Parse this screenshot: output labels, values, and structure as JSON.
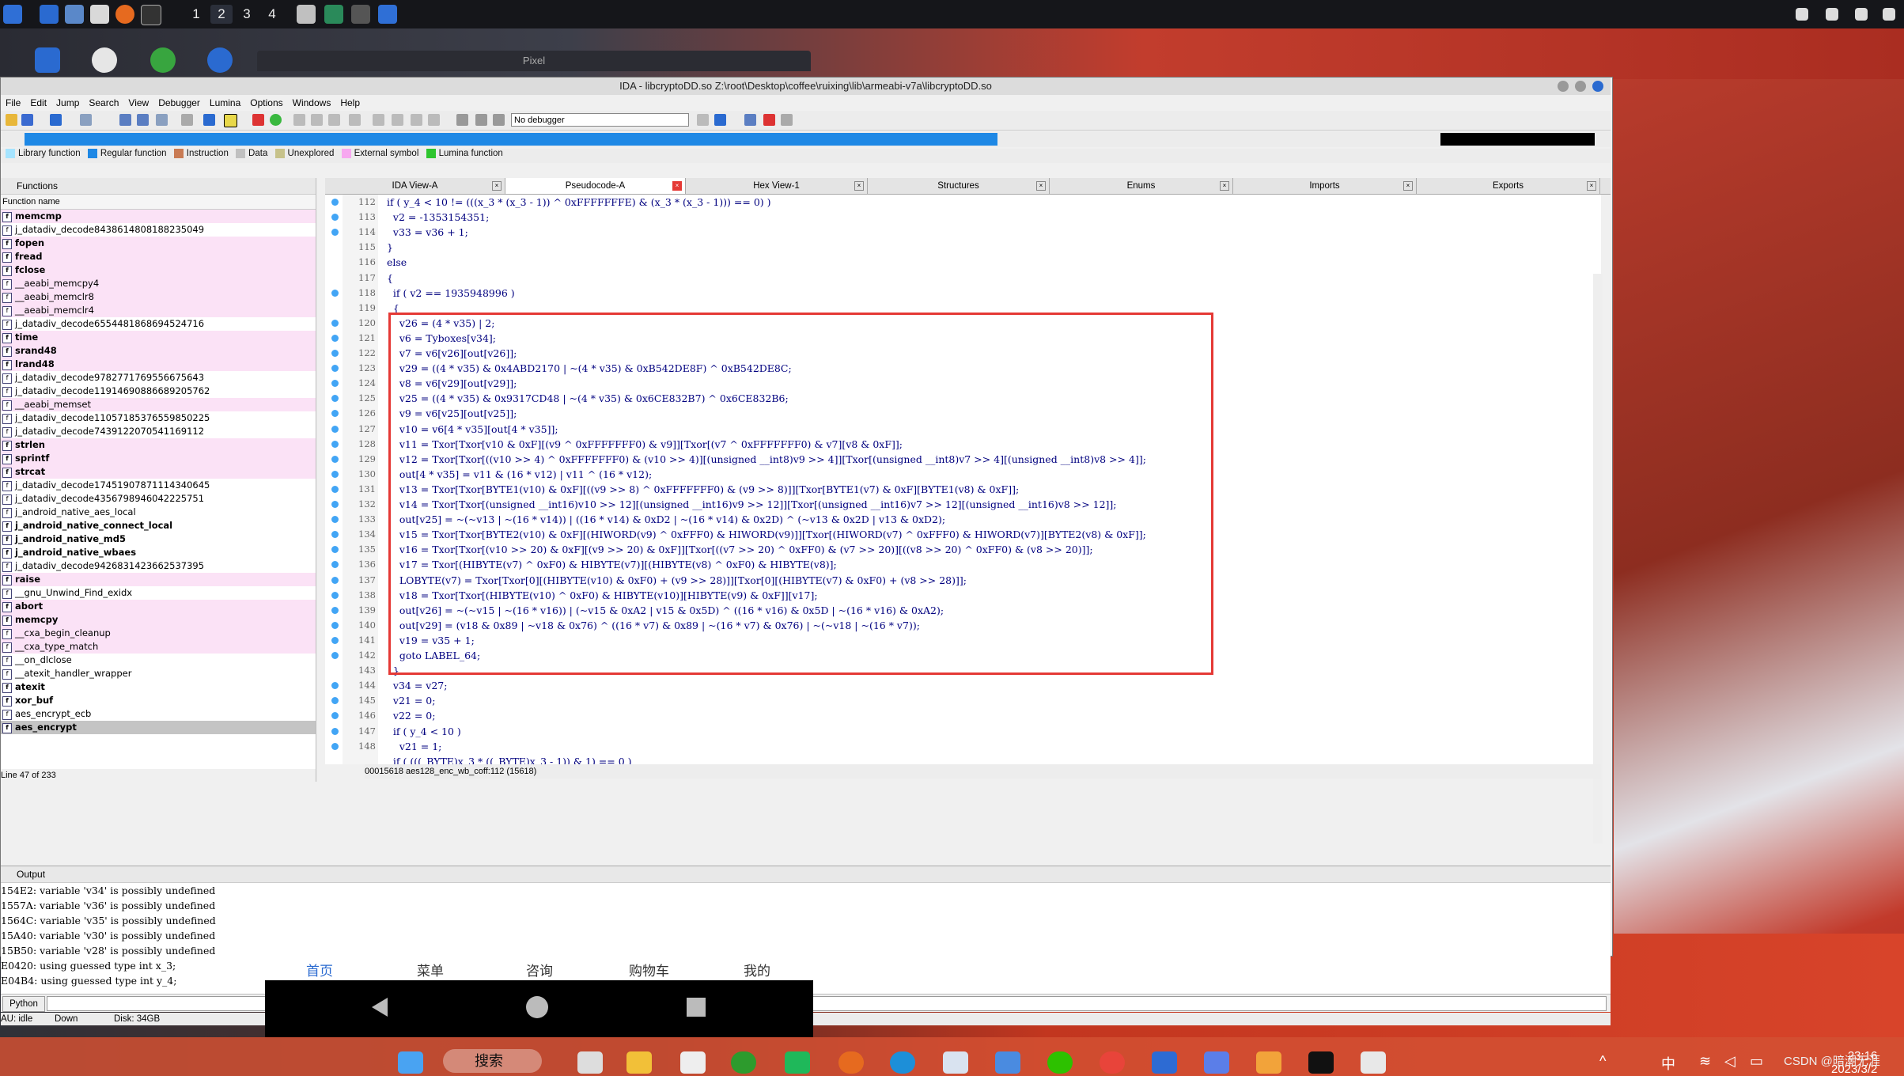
{
  "top_panel": {
    "workspaces": [
      "1",
      "2",
      "3",
      "4"
    ],
    "active_workspace": "2"
  },
  "pixel_window_title": "Pixel",
  "ida": {
    "title": "IDA - libcryptoDD.so Z:\\root\\Desktop\\coffee\\ruixing\\lib\\armeabi-v7a\\libcryptoDD.so",
    "menu": [
      "File",
      "Edit",
      "Jump",
      "Search",
      "View",
      "Debugger",
      "Lumina",
      "Options",
      "Windows",
      "Help"
    ],
    "debugger_select": "No debugger",
    "legend": [
      {
        "label": "Library function",
        "color": "#a6e4ff"
      },
      {
        "label": "Regular function",
        "color": "#1e88e5"
      },
      {
        "label": "Instruction",
        "color": "#c97b54"
      },
      {
        "label": "Data",
        "color": "#c0c0c0"
      },
      {
        "label": "Unexplored",
        "color": "#c7c28a"
      },
      {
        "label": "External symbol",
        "color": "#f7a8f0"
      },
      {
        "label": "Lumina function",
        "color": "#2ec52e"
      }
    ],
    "functions_pane": {
      "title": "Functions",
      "column": "Function name",
      "items": [
        {
          "name": "memcmp",
          "style": "lib bold"
        },
        {
          "name": "j_datadiv_decode8438614808188235049",
          "style": ""
        },
        {
          "name": "fopen",
          "style": "lib bold"
        },
        {
          "name": "fread",
          "style": "lib bold"
        },
        {
          "name": "fclose",
          "style": "lib bold"
        },
        {
          "name": "__aeabi_memcpy4",
          "style": "lib"
        },
        {
          "name": "__aeabi_memclr8",
          "style": "lib"
        },
        {
          "name": "__aeabi_memclr4",
          "style": "lib"
        },
        {
          "name": "j_datadiv_decode6554481868694524716",
          "style": ""
        },
        {
          "name": "time",
          "style": "lib bold"
        },
        {
          "name": "srand48",
          "style": "lib bold"
        },
        {
          "name": "lrand48",
          "style": "lib bold"
        },
        {
          "name": "j_datadiv_decode9782771769556675643",
          "style": ""
        },
        {
          "name": "j_datadiv_decode11914690886689205762",
          "style": ""
        },
        {
          "name": "__aeabi_memset",
          "style": "lib"
        },
        {
          "name": "j_datadiv_decode11057185376559850225",
          "style": ""
        },
        {
          "name": "j_datadiv_decode7439122070541169112",
          "style": ""
        },
        {
          "name": "strlen",
          "style": "lib bold"
        },
        {
          "name": "sprintf",
          "style": "lib bold"
        },
        {
          "name": "strcat",
          "style": "lib bold"
        },
        {
          "name": "j_datadiv_decode17451907871114340645",
          "style": ""
        },
        {
          "name": "j_datadiv_decode4356798946042225751",
          "style": ""
        },
        {
          "name": "j_android_native_aes_local",
          "style": ""
        },
        {
          "name": "j_android_native_connect_local",
          "style": "bold"
        },
        {
          "name": "j_android_native_md5",
          "style": "bold"
        },
        {
          "name": "j_android_native_wbaes",
          "style": "bold"
        },
        {
          "name": "j_datadiv_decode9426831423662537395",
          "style": ""
        },
        {
          "name": "raise",
          "style": "lib bold"
        },
        {
          "name": "__gnu_Unwind_Find_exidx",
          "style": ""
        },
        {
          "name": "abort",
          "style": "lib bold"
        },
        {
          "name": "memcpy",
          "style": "lib bold"
        },
        {
          "name": "__cxa_begin_cleanup",
          "style": "lib"
        },
        {
          "name": "__cxa_type_match",
          "style": "lib"
        },
        {
          "name": "__on_dlclose",
          "style": ""
        },
        {
          "name": "__atexit_handler_wrapper",
          "style": ""
        },
        {
          "name": "atexit",
          "style": "bold"
        },
        {
          "name": "xor_buf",
          "style": "bold"
        },
        {
          "name": "aes_encrypt_ecb",
          "style": ""
        },
        {
          "name": "aes_encrypt",
          "style": "sel"
        }
      ],
      "status": "Line 47 of 233"
    },
    "tabs": [
      {
        "label": "IDA View-A",
        "icon": "ida-view-icon"
      },
      {
        "label": "Pseudocode-A",
        "icon": "pseudocode-icon",
        "active": true
      },
      {
        "label": "Hex View-1",
        "icon": "hex-view-icon"
      },
      {
        "label": "Structures",
        "icon": "structures-icon"
      },
      {
        "label": "Enums",
        "icon": "enums-icon"
      },
      {
        "label": "Imports",
        "icon": "imports-icon"
      },
      {
        "label": "Exports",
        "icon": "exports-icon"
      }
    ],
    "code_lines": [
      {
        "n": "112",
        "dot": true,
        "t": "  if ( y_4 < 10 != (((x_3 * (x_3 - 1)) ^ 0xFFFFFFFE) & (x_3 * (x_3 - 1))) == 0) )"
      },
      {
        "n": "113",
        "dot": true,
        "t": "    v2 = -1353154351;"
      },
      {
        "n": "114",
        "dot": true,
        "t": "    v33 = v36 + 1;"
      },
      {
        "n": "115",
        "dot": false,
        "t": "  }"
      },
      {
        "n": "116",
        "dot": false,
        "t": "  else"
      },
      {
        "n": "117",
        "dot": false,
        "t": "  {"
      },
      {
        "n": "118",
        "dot": true,
        "t": "    if ( v2 == 1935948996 )"
      },
      {
        "n": "119",
        "dot": false,
        "t": "    {"
      },
      {
        "n": "120",
        "dot": true,
        "t": "      v26 = (4 * v35) | 2;"
      },
      {
        "n": "121",
        "dot": true,
        "t": "      v6 = Tyboxes[v34];"
      },
      {
        "n": "122",
        "dot": true,
        "t": "      v7 = v6[v26][out[v26]];"
      },
      {
        "n": "123",
        "dot": true,
        "t": "      v29 = ((4 * v35) & 0x4ABD2170 | ~(4 * v35) & 0xB542DE8F) ^ 0xB542DE8C;"
      },
      {
        "n": "124",
        "dot": true,
        "t": "      v8 = v6[v29][out[v29]];"
      },
      {
        "n": "125",
        "dot": true,
        "t": "      v25 = ((4 * v35) & 0x9317CD48 | ~(4 * v35) & 0x6CE832B7) ^ 0x6CE832B6;"
      },
      {
        "n": "126",
        "dot": true,
        "t": "      v9 = v6[v25][out[v25]];"
      },
      {
        "n": "127",
        "dot": true,
        "t": "      v10 = v6[4 * v35][out[4 * v35]];"
      },
      {
        "n": "128",
        "dot": true,
        "t": "      v11 = Txor[Txor[v10 & 0xF][(v9 ^ 0xFFFFFFF0) & v9]][Txor[(v7 ^ 0xFFFFFFF0) & v7][v8 & 0xF]];"
      },
      {
        "n": "129",
        "dot": true,
        "t": "      v12 = Txor[Txor[((v10 >> 4) ^ 0xFFFFFFF0) & (v10 >> 4)][(unsigned __int8)v9 >> 4]][Txor[(unsigned __int8)v7 >> 4][(unsigned __int8)v8 >> 4]];"
      },
      {
        "n": "130",
        "dot": true,
        "t": "      out[4 * v35] = v11 & (16 * v12) | v11 ^ (16 * v12);"
      },
      {
        "n": "131",
        "dot": true,
        "t": "      v13 = Txor[Txor[BYTE1(v10) & 0xF][((v9 >> 8) ^ 0xFFFFFFF0) & (v9 >> 8)]][Txor[BYTE1(v7) & 0xF][BYTE1(v8) & 0xF]];"
      },
      {
        "n": "132",
        "dot": true,
        "t": "      v14 = Txor[Txor[(unsigned __int16)v10 >> 12][(unsigned __int16)v9 >> 12]][Txor[(unsigned __int16)v7 >> 12][(unsigned __int16)v8 >> 12]];"
      },
      {
        "n": "133",
        "dot": true,
        "t": "      out[v25] = ~(~v13 | ~(16 * v14)) | ((16 * v14) & 0xD2 | ~(16 * v14) & 0x2D) ^ (~v13 & 0x2D | v13 & 0xD2);"
      },
      {
        "n": "134",
        "dot": true,
        "t": "      v15 = Txor[Txor[BYTE2(v10) & 0xF][(HIWORD(v9) ^ 0xFFF0) & HIWORD(v9)]][Txor[(HIWORD(v7) ^ 0xFFF0) & HIWORD(v7)][BYTE2(v8) & 0xF]];"
      },
      {
        "n": "135",
        "dot": true,
        "t": "      v16 = Txor[Txor[(v10 >> 20) & 0xF][(v9 >> 20) & 0xF]][Txor[((v7 >> 20) ^ 0xFF0) & (v7 >> 20)][((v8 >> 20) ^ 0xFF0) & (v8 >> 20)]];"
      },
      {
        "n": "136",
        "dot": true,
        "t": "      v17 = Txor[(HIBYTE(v7) ^ 0xF0) & HIBYTE(v7)][(HIBYTE(v8) ^ 0xF0) & HIBYTE(v8)];"
      },
      {
        "n": "137",
        "dot": true,
        "t": "      LOBYTE(v7) = Txor[Txor[0][(HIBYTE(v10) & 0xF0) + (v9 >> 28)]][Txor[0][(HIBYTE(v7) & 0xF0) + (v8 >> 28)]];"
      },
      {
        "n": "138",
        "dot": true,
        "t": "      v18 = Txor[Txor[(HIBYTE(v10) ^ 0xF0) & HIBYTE(v10)][HIBYTE(v9) & 0xF]][v17];"
      },
      {
        "n": "139",
        "dot": true,
        "t": "      out[v26] = ~(~v15 | ~(16 * v16)) | (~v15 & 0xA2 | v15 & 0x5D) ^ ((16 * v16) & 0x5D | ~(16 * v16) & 0xA2);"
      },
      {
        "n": "140",
        "dot": true,
        "t": "      out[v29] = (v18 & 0x89 | ~v18 & 0x76) ^ ((16 * v7) & 0x89 | ~(16 * v7) & 0x76) | ~(~v18 | ~(16 * v7));"
      },
      {
        "n": "141",
        "dot": true,
        "t": "      v19 = v35 + 1;"
      },
      {
        "n": "142",
        "dot": true,
        "t": "      goto LABEL_64;"
      },
      {
        "n": "143",
        "dot": false,
        "t": "    }"
      },
      {
        "n": "144",
        "dot": true,
        "t": "    v34 = v27;"
      },
      {
        "n": "145",
        "dot": true,
        "t": "    v21 = 0;"
      },
      {
        "n": "146",
        "dot": true,
        "t": "    v22 = 0;"
      },
      {
        "n": "147",
        "dot": true,
        "t": "    if ( y_4 < 10 )"
      },
      {
        "n": "148",
        "dot": true,
        "t": "      v21 = 1;"
      },
      {
        "n": "",
        "dot": false,
        "t": "    if ( (((_BYTE)x_3 * ((_BYTE)x_3 - 1)) & 1) == 0 )"
      }
    ],
    "code_status": "00015618 aes128_enc_wb_coff:112 (15618)",
    "output": {
      "title": "Output",
      "lines": [
        "154E2: variable 'v34' is possibly undefined",
        "1557A: variable 'v36' is possibly undefined",
        "1564C: variable 'v35' is possibly undefined",
        "15A40: variable 'v30' is possibly undefined",
        "15B50: variable 'v28' is possibly undefined",
        "E0420: using guessed type int x_3;",
        "E04B4: using guessed type int y_4;"
      ]
    },
    "python_button": "Python",
    "status": {
      "au": "AU:  idle",
      "dir": "Down",
      "disk": "Disk: 34GB"
    }
  },
  "phone": {
    "nav": [
      "首页",
      "菜单",
      "咨询",
      "购物车",
      "我的"
    ]
  },
  "taskbar": {
    "search": "搜索",
    "ime": "中",
    "time": "23:16",
    "date": "2023/3/2"
  },
  "watermark": "CSDN @暗潮无涯"
}
